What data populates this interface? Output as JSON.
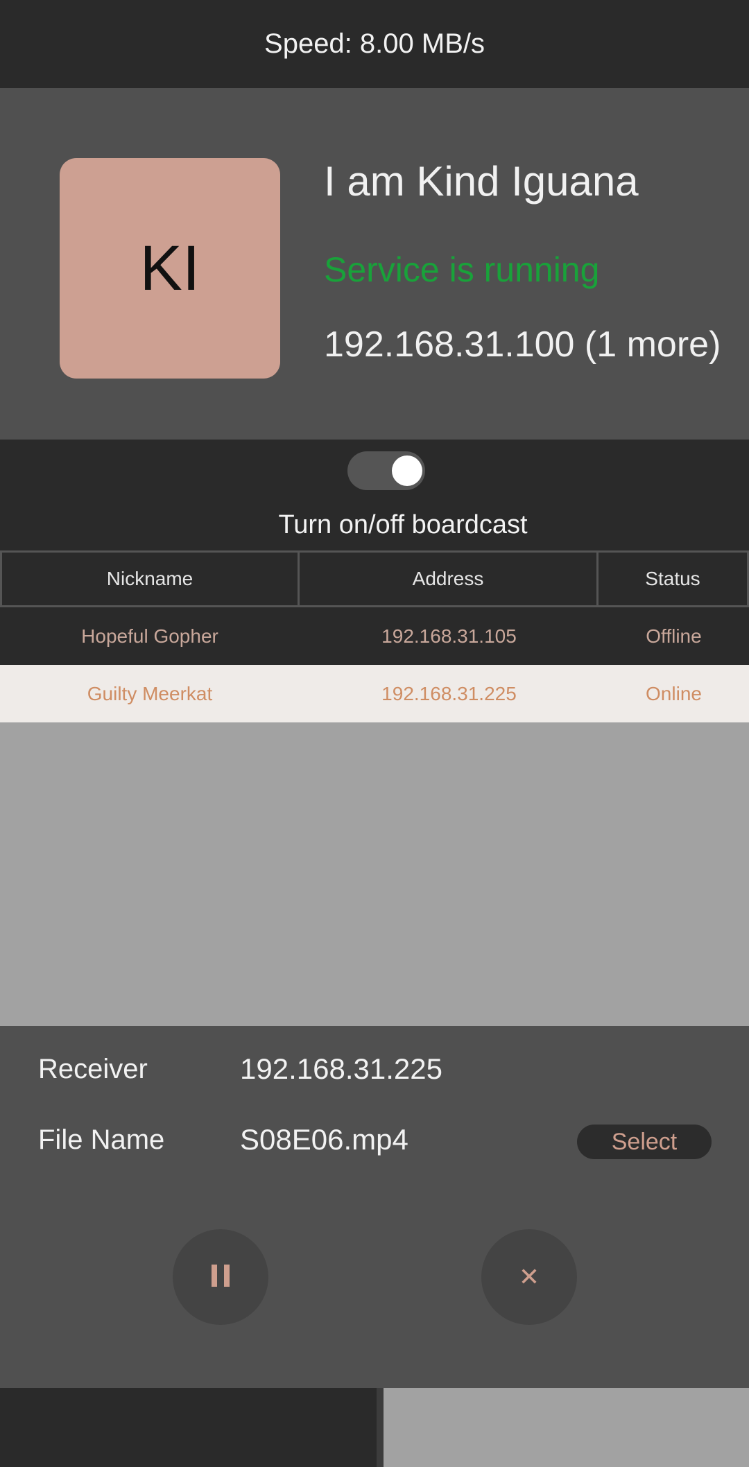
{
  "topbar": {
    "speed_text": "Speed: 8.00 MB/s"
  },
  "profile": {
    "avatar_initials": "KI",
    "name": "I am Kind Iguana",
    "status": "Service is running",
    "ip_summary": "192.168.31.100 (1 more)"
  },
  "broadcast": {
    "label": "Turn on/off boardcast",
    "enabled": true
  },
  "peers": {
    "columns": [
      "Nickname",
      "Address",
      "Status"
    ],
    "rows": [
      {
        "nickname": "Hopeful Gopher",
        "address": "192.168.31.105",
        "status": "Offline"
      },
      {
        "nickname": "Guilty Meerkat",
        "address": "192.168.31.225",
        "status": "Online"
      }
    ]
  },
  "transfer": {
    "receiver_label": "Receiver",
    "receiver_value": "192.168.31.225",
    "file_label": "File Name",
    "file_value": "S08E06.mp4",
    "select_label": "Select",
    "pause_icon": "pause-icon",
    "close_icon": "close-icon",
    "close_glyph": "✕"
  },
  "colors": {
    "status_running": "#19a23a",
    "accent": "#cf9f8e",
    "avatar_bg": "#cda092"
  }
}
